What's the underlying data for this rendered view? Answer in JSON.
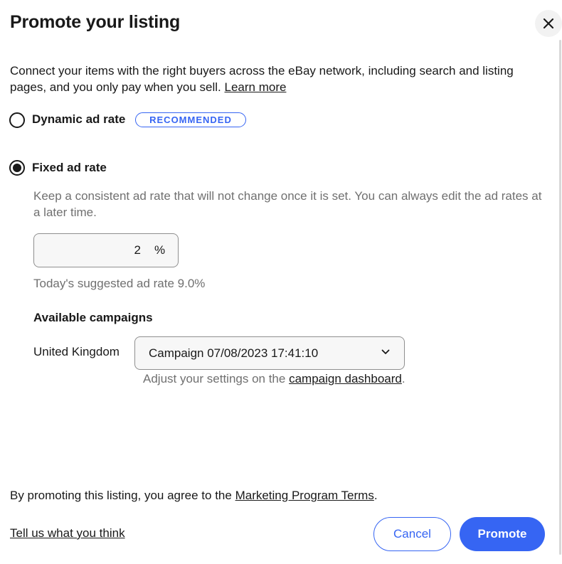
{
  "dialog": {
    "title": "Promote your listing",
    "close_icon": "close-icon"
  },
  "intro": {
    "text": "Connect your items with the right buyers across the eBay network, including search and listing pages, and you only pay when you sell.",
    "learn_more": "Learn more"
  },
  "options": {
    "dynamic": {
      "label": "Dynamic ad rate",
      "badge": "RECOMMENDED",
      "selected": false
    },
    "fixed": {
      "label": "Fixed ad rate",
      "selected": true
    }
  },
  "fixed_rate": {
    "description": "Keep a consistent ad rate that will not change once it is set. You can always edit the ad rates at a later time.",
    "value": "2",
    "unit": "%",
    "suggested": "Today's suggested ad rate 9.0%"
  },
  "campaigns": {
    "heading": "Available campaigns",
    "country": "United Kingdom",
    "selected": "Campaign 07/08/2023 17:41:10",
    "dropdown_icon": "chevron-down-icon",
    "adjust_prefix": "Adjust your settings on the",
    "dashboard_link": "campaign dashboard",
    "adjust_suffix": "."
  },
  "footer": {
    "terms_prefix": "By promoting this listing, you agree to the",
    "terms_link": "Marketing Program Terms",
    "terms_suffix": ".",
    "feedback": "Tell us what you think",
    "cancel": "Cancel",
    "promote": "Promote"
  },
  "colors": {
    "accent": "#3665f3",
    "text": "#191919",
    "secondary_text": "#707070"
  }
}
